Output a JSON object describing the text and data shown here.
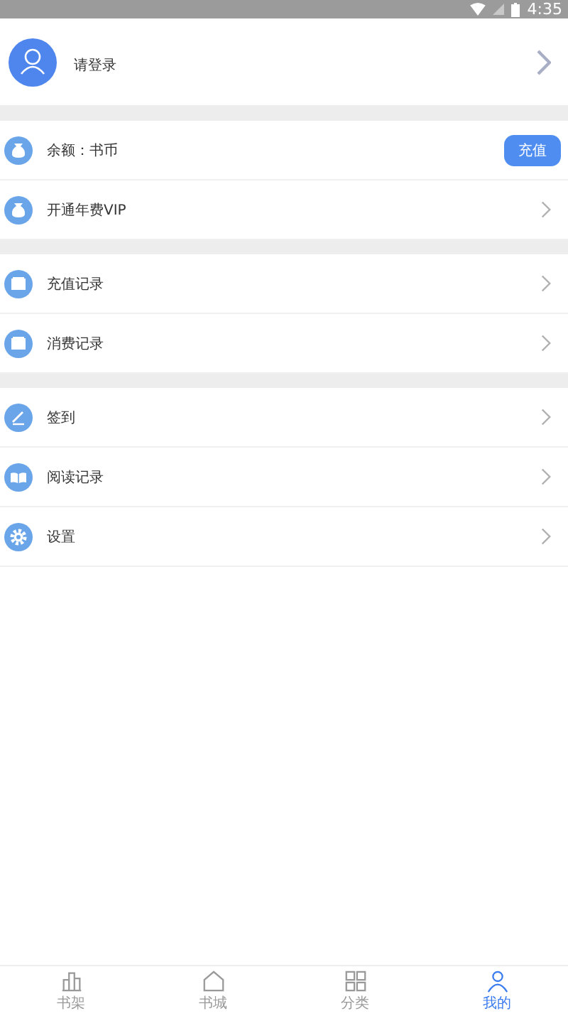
{
  "status_bar": {
    "time": "4:35"
  },
  "profile": {
    "login_label": "请登录"
  },
  "sections": [
    {
      "rows": [
        {
          "label": "余额：书币",
          "kind": "button",
          "action": "充值"
        },
        {
          "label": "开通年费VIP",
          "kind": "chevron"
        }
      ]
    },
    {
      "rows": [
        {
          "label": "充值记录",
          "kind": "chevron"
        },
        {
          "label": "消费记录",
          "kind": "chevron"
        }
      ]
    },
    {
      "rows": [
        {
          "label": "签到",
          "kind": "chevron"
        },
        {
          "label": "阅读记录",
          "kind": "chevron"
        },
        {
          "label": "设置",
          "kind": "chevron"
        }
      ]
    }
  ],
  "tab_bar": [
    {
      "label": "书架",
      "selected": false
    },
    {
      "label": "书城",
      "selected": false
    },
    {
      "label": "分类",
      "selected": false
    },
    {
      "label": "我的",
      "selected": true
    }
  ]
}
